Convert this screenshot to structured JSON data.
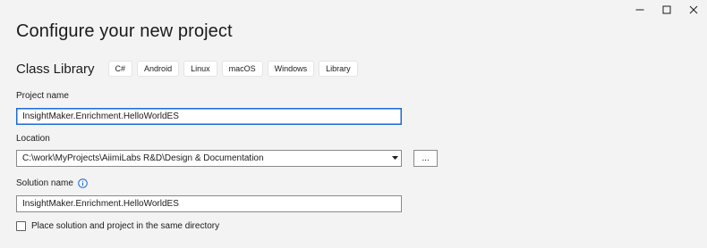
{
  "window": {
    "controls": {
      "minimize_icon": "minimize-icon",
      "maximize_icon": "maximize-icon",
      "close_icon": "close-icon"
    }
  },
  "page": {
    "title": "Configure your new project"
  },
  "template": {
    "name": "Class Library",
    "tags": [
      "C#",
      "Android",
      "Linux",
      "macOS",
      "Windows",
      "Library"
    ]
  },
  "project_name": {
    "label": "Project name",
    "value": "InsightMaker.Enrichment.HelloWorldES"
  },
  "location": {
    "label": "Location",
    "value": "C:\\work\\MyProjects\\AiimiLabs R&D\\Design & Documentation",
    "browse_label": "..."
  },
  "solution_name": {
    "label": "Solution name",
    "value": "InsightMaker.Enrichment.HelloWorldES",
    "info_icon": "info-icon"
  },
  "same_directory": {
    "label": "Place solution and project in the same directory",
    "checked": false
  },
  "colors": {
    "background": "#f3f3f3",
    "focus_accent": "#1a6ad6",
    "info_accent": "#1a6ad6"
  }
}
